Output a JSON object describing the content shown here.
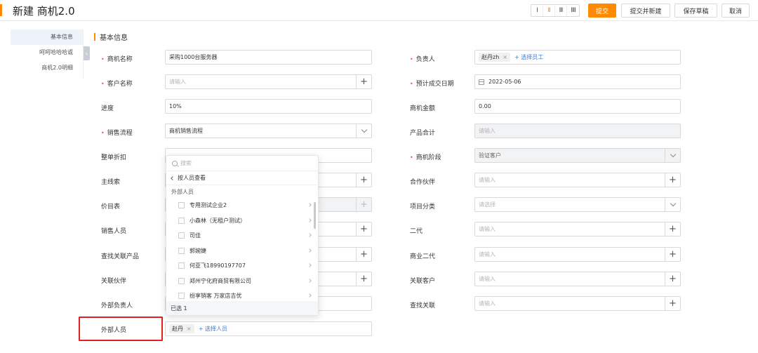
{
  "header": {
    "title": "新建 商机2.0",
    "view_options": [
      "I",
      "II",
      "III",
      "IIII"
    ],
    "active_view": 1,
    "submit_label": "提交",
    "submit_new_label": "提交并新建",
    "save_draft_label": "保存草稿",
    "cancel_label": "取消"
  },
  "sidebar": {
    "items": [
      {
        "label": "基本信息",
        "active": true
      },
      {
        "label": "呵呵哈哈哈或",
        "active": false
      },
      {
        "label": "商机2.0明细",
        "active": false
      }
    ]
  },
  "section": {
    "title": "基本信息"
  },
  "form": {
    "left": [
      {
        "label": "商机名称",
        "required": true,
        "value": "采购1000台服务器"
      },
      {
        "label": "客户名称",
        "required": true,
        "placeholder": "请输入"
      },
      {
        "label": "进度",
        "required": false,
        "value": "10%"
      },
      {
        "label": "销售流程",
        "required": true,
        "value": "商机销售流程"
      },
      {
        "label": "整单折扣",
        "required": false
      },
      {
        "label": "主线索",
        "required": false
      },
      {
        "label": "价目表",
        "required": false
      },
      {
        "label": "销售人员",
        "required": false
      },
      {
        "label": "查找关联产品",
        "required": false
      },
      {
        "label": "关联伙伴",
        "required": false
      },
      {
        "label": "外部负责人",
        "required": false
      },
      {
        "label": "外部人员",
        "required": false,
        "tag": "赵丹",
        "add_label": "+ 选择人员"
      }
    ],
    "right": [
      {
        "label": "负责人",
        "required": true,
        "tag": "赵丹zh",
        "add_label": "+ 选择员工"
      },
      {
        "label": "预计成交日期",
        "required": true,
        "value": "2022-05-06"
      },
      {
        "label": "商机金额",
        "required": false,
        "value": "0.00"
      },
      {
        "label": "产品合计",
        "required": false,
        "placeholder": "请输入"
      },
      {
        "label": "商机阶段",
        "required": true,
        "value": "验证客户"
      },
      {
        "label": "合作伙伴",
        "required": false,
        "placeholder": "请输入"
      },
      {
        "label": "项目分类",
        "required": false,
        "placeholder": "请选择"
      },
      {
        "label": "二代",
        "required": false,
        "placeholder": "请输入"
      },
      {
        "label": "商业二代",
        "required": false,
        "placeholder": "请输入"
      },
      {
        "label": "关联客户",
        "required": false,
        "placeholder": "请输入"
      },
      {
        "label": "查找关联",
        "required": false,
        "placeholder": "请输入"
      }
    ]
  },
  "picker": {
    "search_placeholder": "搜索",
    "back_label": "按人员查看",
    "group_label": "外部人员",
    "items": [
      "专用测试企业2",
      "小森林（无租户测试）",
      "司佳",
      "郭婉婕",
      "何亚飞18990197707",
      "郑州宁化府商贸有限公司",
      "纷享销客 万家店吉优"
    ],
    "footer": "已选 1"
  },
  "colors": {
    "accent": "#ff8a00",
    "link": "#3a7bd5",
    "highlight": "#e0201f"
  }
}
